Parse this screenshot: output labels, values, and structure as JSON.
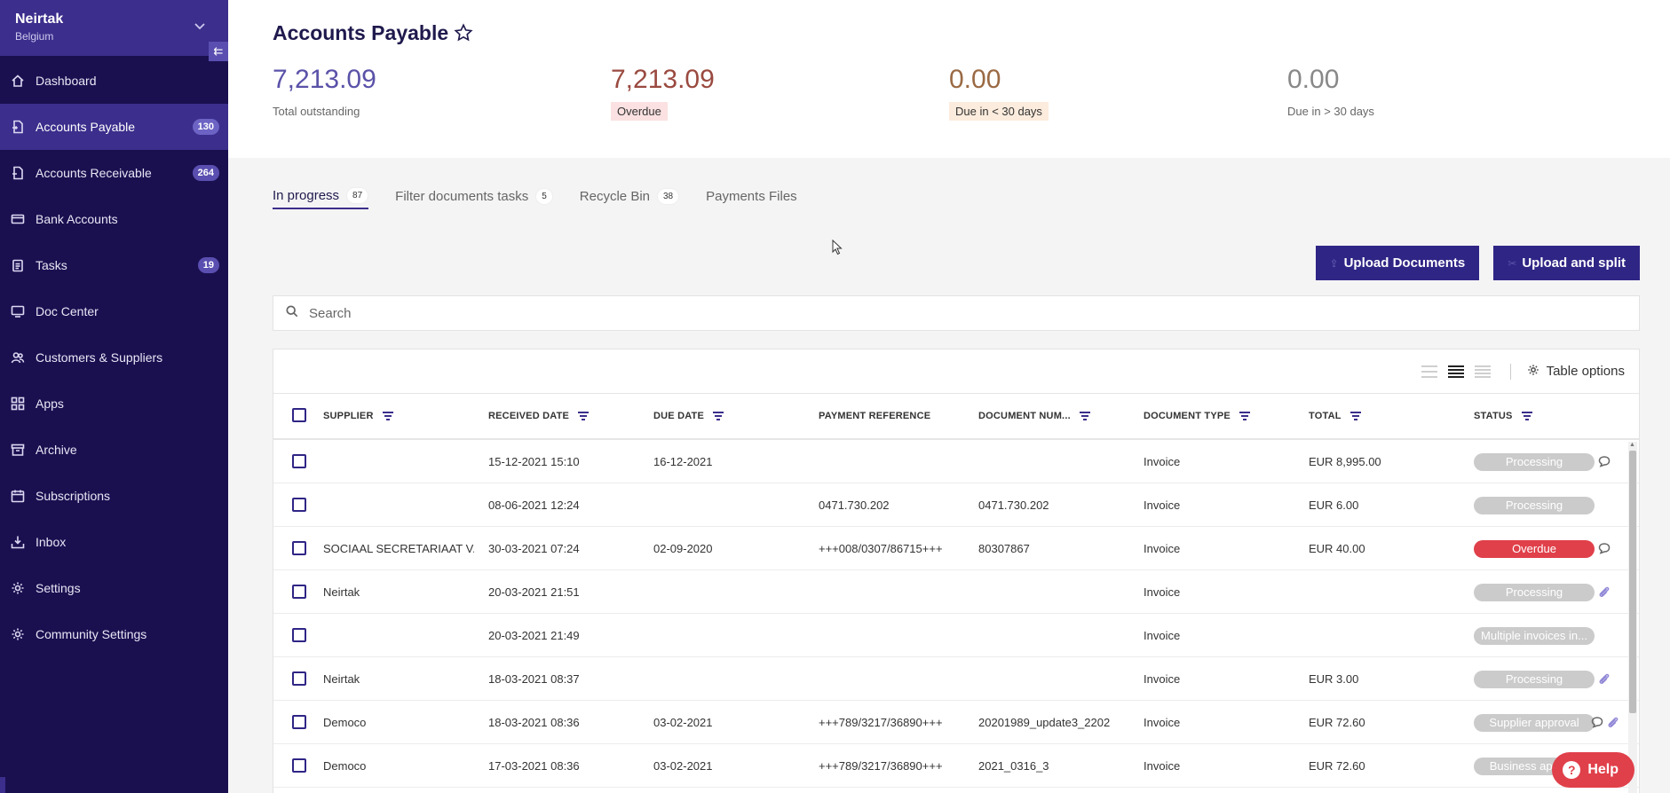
{
  "sidebar": {
    "company": "Neirtak",
    "country": "Belgium",
    "collapse_glyph": "⇇",
    "items": [
      {
        "label": "Dashboard",
        "icon": "home-icon",
        "badge": ""
      },
      {
        "label": "Accounts Payable",
        "icon": "document-in-icon",
        "badge": "130",
        "active": true
      },
      {
        "label": "Accounts Receivable",
        "icon": "document-out-icon",
        "badge": "264"
      },
      {
        "label": "Bank Accounts",
        "icon": "card-icon",
        "badge": ""
      },
      {
        "label": "Tasks",
        "icon": "clipboard-icon",
        "badge": "19"
      },
      {
        "label": "Doc Center",
        "icon": "doc-center-icon",
        "badge": ""
      },
      {
        "label": "Customers & Suppliers",
        "icon": "people-icon",
        "badge": ""
      },
      {
        "label": "Apps",
        "icon": "apps-icon",
        "badge": ""
      },
      {
        "label": "Archive",
        "icon": "archive-icon",
        "badge": ""
      },
      {
        "label": "Subscriptions",
        "icon": "calendar-icon",
        "badge": ""
      },
      {
        "label": "Inbox",
        "icon": "inbox-icon",
        "badge": ""
      },
      {
        "label": "Settings",
        "icon": "gear-icon",
        "badge": ""
      },
      {
        "label": "Community Settings",
        "icon": "gear-icon",
        "badge": ""
      }
    ]
  },
  "page": {
    "title": "Accounts Payable",
    "kpis": [
      {
        "value": "7,213.09",
        "label": "Total outstanding"
      },
      {
        "value": "7,213.09",
        "label": "Overdue"
      },
      {
        "value": "0.00",
        "label": "Due in < 30 days"
      },
      {
        "value": "0.00",
        "label": "Due in > 30 days"
      }
    ],
    "tabs": [
      {
        "label": "In progress",
        "badge": "87"
      },
      {
        "label": "Filter documents tasks",
        "badge": "5"
      },
      {
        "label": "Recycle Bin",
        "badge": "38"
      },
      {
        "label": "Payments Files",
        "badge": ""
      }
    ]
  },
  "actions": {
    "upload_documents": "Upload Documents",
    "upload_split": "Upload and split"
  },
  "search": {
    "placeholder": "Search"
  },
  "table": {
    "options_label": "Table options",
    "columns": [
      "SUPPLIER",
      "RECEIVED DATE",
      "DUE DATE",
      "PAYMENT REFERENCE",
      "DOCUMENT NUM...",
      "DOCUMENT TYPE",
      "TOTAL",
      "STATUS"
    ],
    "rows": [
      {
        "supplier": "",
        "received": "15-12-2021 15:10",
        "due": "16-12-2021",
        "payref": "",
        "docnum": "",
        "doctype": "Invoice",
        "total": "EUR 8,995.00",
        "status": "Processing",
        "status_type": "grey",
        "icons": [
          "comment"
        ]
      },
      {
        "supplier": "",
        "received": "08-06-2021 12:24",
        "due": "",
        "payref": "0471.730.202",
        "docnum": "0471.730.202",
        "doctype": "Invoice",
        "total": "EUR 6.00",
        "status": "Processing",
        "status_type": "grey",
        "icons": []
      },
      {
        "supplier": "SOCIAAL SECRETARIAAT V...",
        "received": "30-03-2021 07:24",
        "due": "02-09-2020",
        "payref": "+++008/0307/86715+++",
        "docnum": "80307867",
        "doctype": "Invoice",
        "total": "EUR 40.00",
        "status": "Overdue",
        "status_type": "overdue",
        "icons": [
          "comment"
        ]
      },
      {
        "supplier": "Neirtak",
        "received": "20-03-2021 21:51",
        "due": "",
        "payref": "",
        "docnum": "",
        "doctype": "Invoice",
        "total": "",
        "status": "Processing",
        "status_type": "grey",
        "icons": [
          "clip"
        ]
      },
      {
        "supplier": "",
        "received": "20-03-2021 21:49",
        "due": "",
        "payref": "",
        "docnum": "",
        "doctype": "Invoice",
        "total": "",
        "status": "Multiple invoices in...",
        "status_type": "grey",
        "icons": []
      },
      {
        "supplier": "Neirtak",
        "received": "18-03-2021 08:37",
        "due": "",
        "payref": "",
        "docnum": "",
        "doctype": "Invoice",
        "total": "EUR 3.00",
        "status": "Processing",
        "status_type": "grey",
        "icons": [
          "clip"
        ]
      },
      {
        "supplier": "Democo",
        "received": "18-03-2021 08:36",
        "due": "03-02-2021",
        "payref": "+++789/3217/36890+++",
        "docnum": "20201989_update3_2202",
        "doctype": "Invoice",
        "total": "EUR 72.60",
        "status": "Supplier approval",
        "status_type": "grey",
        "icons": [
          "comment",
          "clip"
        ]
      },
      {
        "supplier": "Democo",
        "received": "17-03-2021 08:36",
        "due": "03-02-2021",
        "payref": "+++789/3217/36890+++",
        "docnum": "2021_0316_3",
        "doctype": "Invoice",
        "total": "EUR 72.60",
        "status": "Business appro...",
        "status_type": "grey",
        "icons": []
      }
    ]
  },
  "help": {
    "label": "Help",
    "glyph": "?"
  },
  "colors": {
    "sidebar_bg": "#1a1050",
    "accent": "#2f2585",
    "overdue": "#e0404a"
  }
}
